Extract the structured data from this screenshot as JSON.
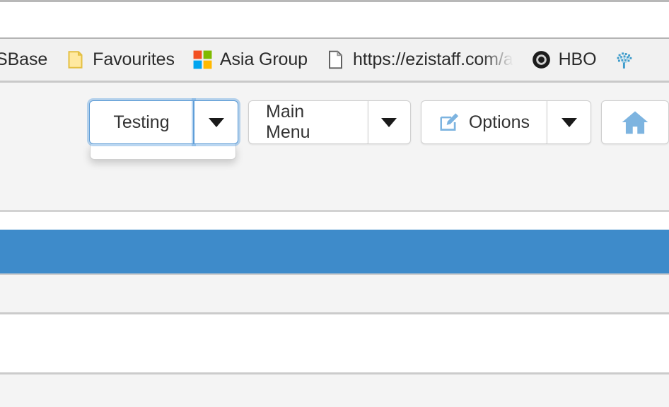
{
  "browser": {
    "bookmarks": [
      {
        "label": "SBase",
        "icon": "none",
        "truncated": false
      },
      {
        "label": "Favourites",
        "icon": "folder-icon",
        "truncated": false
      },
      {
        "label": "Asia Group",
        "icon": "microsoft-logo-icon",
        "truncated": false
      },
      {
        "label": "https://ezistaff.com/a",
        "icon": "document-icon",
        "truncated": true
      },
      {
        "label": "HBO",
        "icon": "record-circle-icon",
        "truncated": false
      },
      {
        "label": "",
        "icon": "blue-tree-icon",
        "truncated": false
      }
    ]
  },
  "toolbar": {
    "buttons": [
      {
        "label": "Testing",
        "has_caret": true,
        "icon": "none",
        "open": true
      },
      {
        "label": "Main Menu",
        "has_caret": true,
        "icon": "none",
        "open": false
      },
      {
        "label": "Options",
        "has_caret": true,
        "icon": "edit-square-icon",
        "open": false
      },
      {
        "label": "",
        "has_caret": false,
        "icon": "home-icon",
        "open": false
      }
    ],
    "dropdown_open_for": "Testing"
  },
  "colors": {
    "accent_blue": "#3e8bca",
    "icon_blue": "#7db4e0",
    "focus_blue": "#5b9ad5",
    "bookmark_folder_yellow": "#efd14f",
    "panel_grey": "#f4f4f4",
    "bar_border": "#cbcbcb"
  },
  "content": {
    "blue_bar_text": "",
    "panel_a_text": "",
    "panel_b_text": "",
    "panel_c_text": ""
  }
}
